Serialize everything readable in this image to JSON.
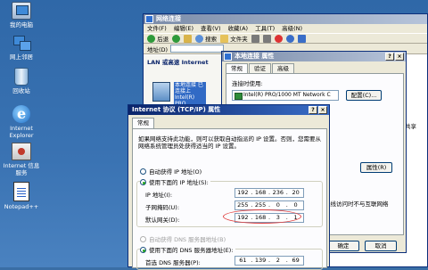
{
  "desktop_icons": [
    {
      "label": "我的电脑",
      "icon": "computer-icon"
    },
    {
      "label": "网上邻居",
      "icon": "network-icon"
    },
    {
      "label": "回收站",
      "icon": "recycle-bin-icon"
    },
    {
      "label": "Internet Explorer",
      "icon": "ie-icon"
    },
    {
      "label": "Internet 信息服务",
      "icon": "iis-icon"
    },
    {
      "label": "Notepad++",
      "icon": "notepad-icon"
    }
  ],
  "network_window": {
    "title": "网络连接",
    "menu": [
      "文件(F)",
      "编辑(E)",
      "查看(V)",
      "收藏(A)",
      "工具(T)",
      "高级(N)"
    ],
    "toolbar": {
      "back": "后退",
      "search": "搜索",
      "folders": "文件夹"
    },
    "address_label": "地址(D)",
    "lan_header": "LAN 或高速 Internet",
    "connection_label": "本地连接 已连接上 Intel(R) PRO",
    "side_text": "共享"
  },
  "lan_window": {
    "title": "本地连接 属性",
    "tabs": [
      "常规",
      "验证",
      "高级"
    ],
    "connect_using_label": "连接时使用:",
    "adapter": "Intel(R) PRO/1000 MT Network C",
    "configure_button": "配置(C)...",
    "properties_button": "属性(R)",
    "network_notify_text": "无线访问时不与互联网络",
    "ok_button": "确定",
    "cancel_button": "取消"
  },
  "tcp_window": {
    "title": "Internet 协议 (TCP/IP) 属性",
    "tab": "常规",
    "description": "如果网络支持此功能，则可以获取自动指派的 IP 设置。否则，您需要从网络系统管理员处获得适当的 IP 设置。",
    "auto_ip_label": "自动获得 IP 地址(O)",
    "manual_ip_label": "使用下面的 IP 地址(S):",
    "ip_label": "IP 地址(I):",
    "ip_value": [
      "192",
      "168",
      "236",
      "20"
    ],
    "mask_label": "子网掩码(U):",
    "mask_value": [
      "255",
      "255",
      "0",
      "0"
    ],
    "gateway_label": "默认网关(D):",
    "gateway_value": [
      "192",
      "168",
      "3",
      "1"
    ],
    "auto_dns_label": "自动获得 DNS 服务器地址(B)",
    "manual_dns_label": "使用下面的 DNS 服务器地址(E):",
    "dns_label": "首选 DNS 服务器(P):",
    "dns_value": [
      "61",
      "139",
      "2",
      "69"
    ]
  }
}
